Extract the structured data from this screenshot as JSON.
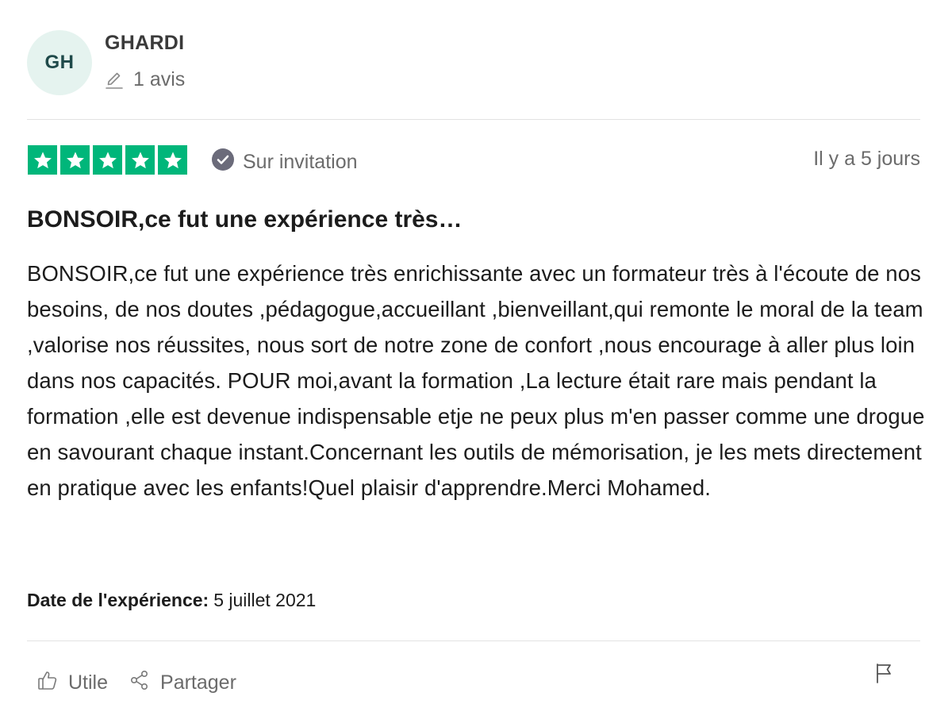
{
  "colors": {
    "star_background": "#00b67a",
    "avatar_background": "#e5f3ef",
    "verified_badge": "#6b6b7a"
  },
  "reviewer": {
    "initials": "GH",
    "name": "GHARDI",
    "review_count": "1 avis"
  },
  "rating": {
    "stars": 5,
    "max_stars": 5
  },
  "badge": {
    "icon": "check-circle-icon",
    "label": "Sur invitation"
  },
  "date_ago": "Il y a 5 jours",
  "review": {
    "title": "BONSOIR,ce fut une expérience très…",
    "body": "BONSOIR,ce fut une expérience très enrichissante avec un formateur très à l'écoute de nos besoins, de nos doutes ,pédagogue,accueillant ,bienveillant,qui remonte le moral de la team ,valorise nos réussites, nous sort de notre zone de confort ,nous encourage à aller plus loin dans nos capacités. POUR moi,avant la formation ,La lecture était rare mais pendant la formation ,elle est devenue indispensable etje ne peux plus m'en passer comme une drogue en savourant chaque instant.Concernant les outils de mémorisation, je les mets directement en pratique avec les enfants!Quel plaisir d'apprendre.Merci Mohamed."
  },
  "experience": {
    "label": "Date de l'expérience:",
    "date": "5 juillet 2021"
  },
  "actions": {
    "useful": {
      "label": "Utile",
      "icon": "thumbs-up-icon"
    },
    "share": {
      "label": "Partager",
      "icon": "share-icon"
    },
    "report": {
      "icon": "flag-icon"
    }
  }
}
